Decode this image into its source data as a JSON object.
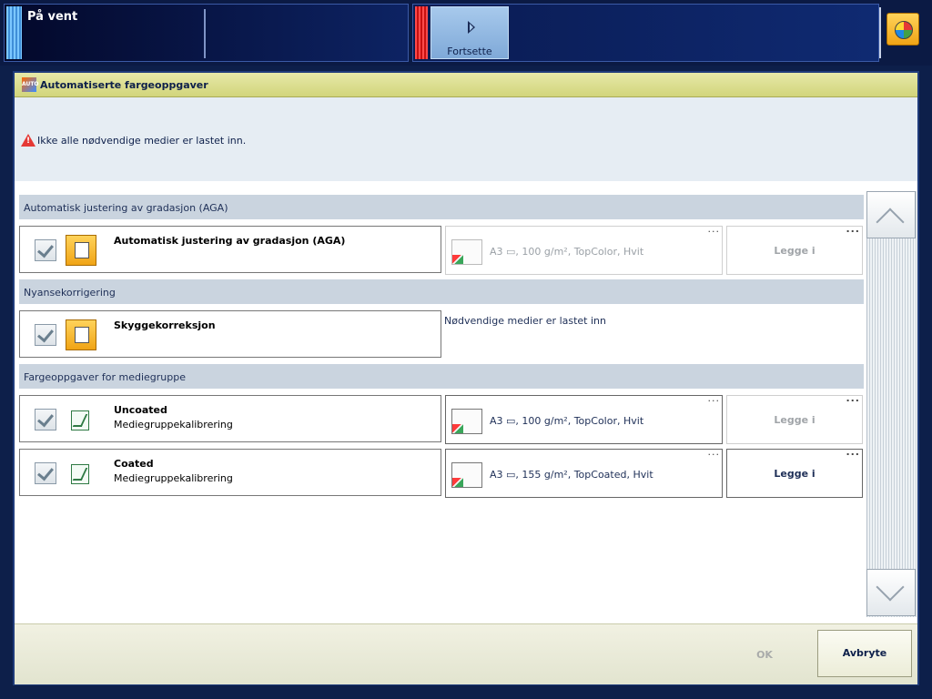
{
  "topbar": {
    "status_title": "På vent",
    "continue_label": "Fortsette"
  },
  "dialog": {
    "title": "Automatiserte fargeoppgaver",
    "warning": "Ikke alle nødvendige medier er lastet inn.",
    "sections": {
      "aga": {
        "header": "Automatisk justering av gradasjon (AGA)"
      },
      "shade": {
        "header": "Nyansekorrigering"
      },
      "media_group": {
        "header": "Fargeoppgaver for mediegruppe"
      }
    },
    "tasks": {
      "aga": {
        "name": "Automatisk justering av gradasjon (AGA)",
        "media": "A3 ▭, 100 g/m², TopColor, Hvit",
        "media_dots": "...",
        "load_label": "Legge i",
        "load_dots": "..."
      },
      "shade": {
        "name": "Skyggekorreksjon",
        "media_status": "Nødvendige medier er lastet inn"
      },
      "uncoated": {
        "name": "Uncoated",
        "sub": "Mediegruppekalibrering",
        "media": "A3 ▭, 100 g/m², TopColor, Hvit",
        "media_dots": "...",
        "load_label": "Legge i",
        "load_dots": "..."
      },
      "coated": {
        "name": "Coated",
        "sub": "Mediegruppekalibrering",
        "media": "A3 ▭, 155 g/m², TopCoated, Hvit",
        "media_dots": "...",
        "load_label": "Legge i",
        "load_dots": "..."
      }
    },
    "footer": {
      "ok_label": "OK",
      "cancel_label": "Avbryte"
    }
  },
  "colors": {
    "header_bg": "#d2d57b",
    "section_bg": "#cad4df",
    "warning_red": "#e53935",
    "accent_orange": "#f0a416"
  }
}
